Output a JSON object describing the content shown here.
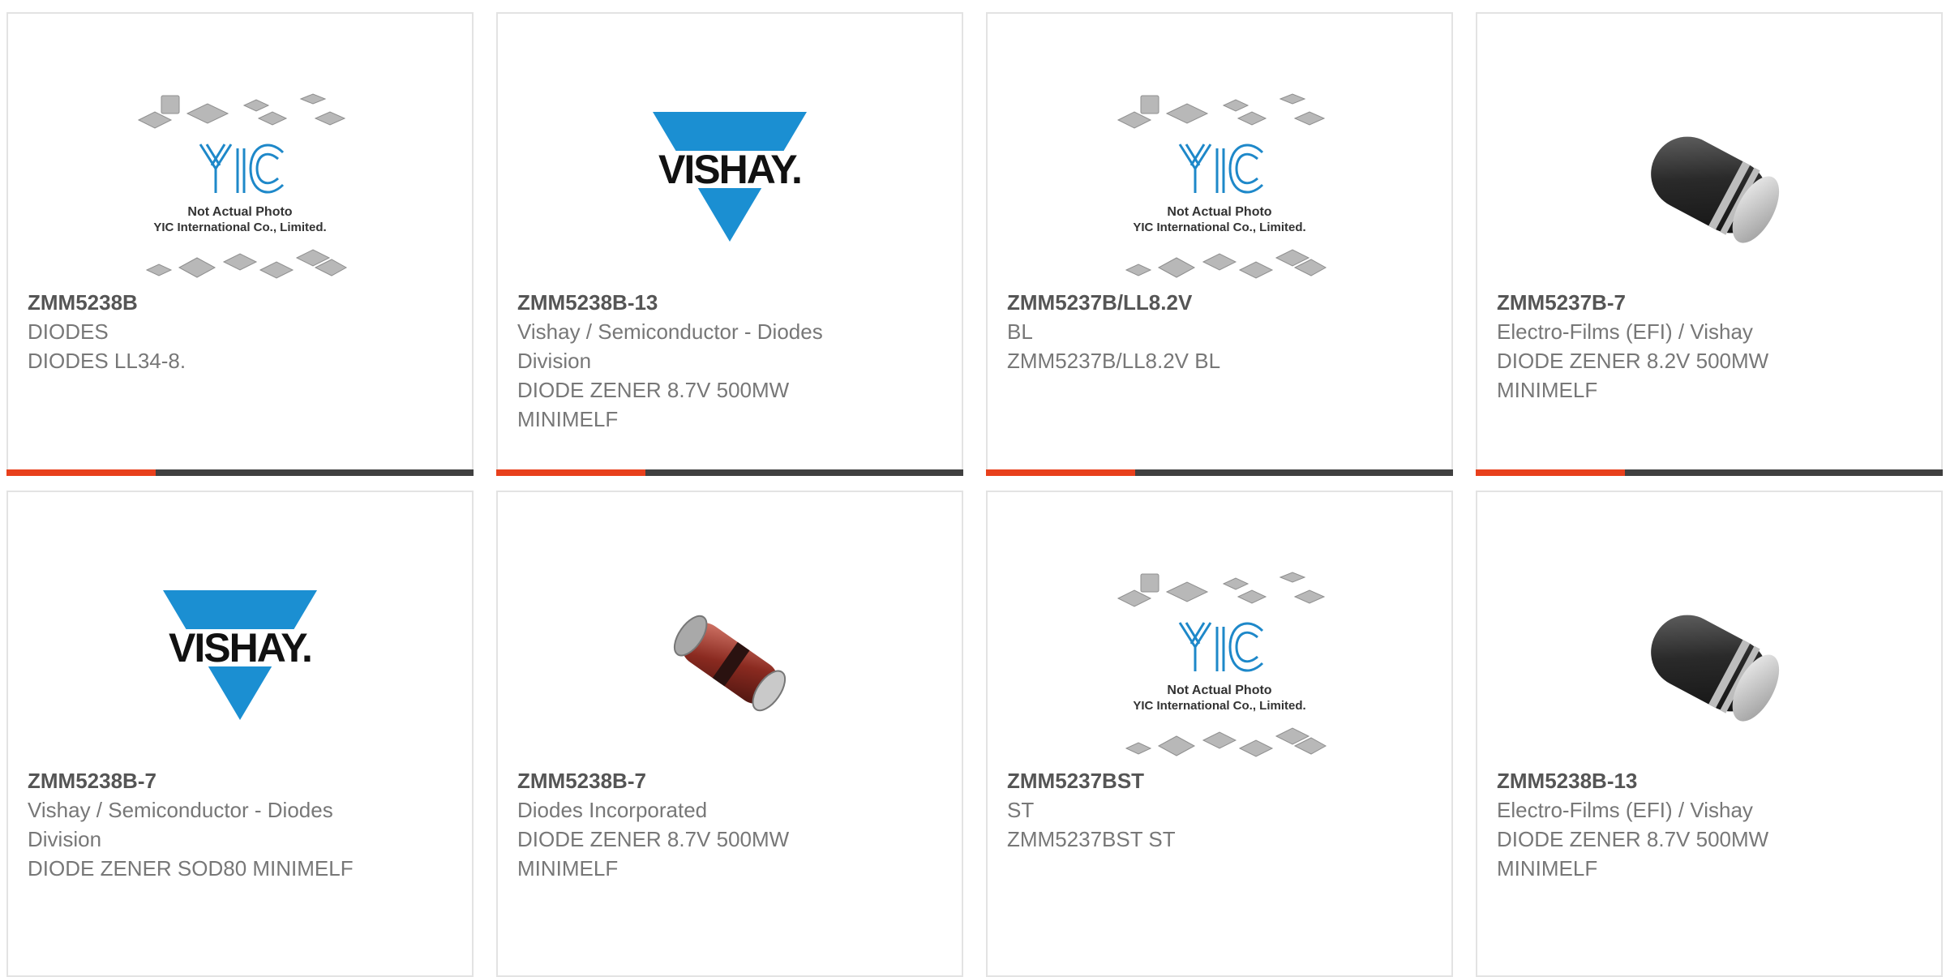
{
  "colors": {
    "accent": "#e8401c",
    "bar": "#404040",
    "vishay_blue": "#1b8fd2",
    "yic_blue": "#1e88c9"
  },
  "products": [
    {
      "part": "ZMM5238B",
      "manufacturer": "DIODES",
      "description": "DIODES LL34-8.",
      "image": "yic-placeholder",
      "image_text": {
        "line1": "Not Actual Photo",
        "line2": "YIC International Co., Limited.",
        "logo": "YIC"
      }
    },
    {
      "part": "ZMM5238B-13",
      "manufacturer": "Vishay / Semiconductor - Diodes Division",
      "description": "DIODE ZENER 8.7V 500MW MINIMELF",
      "image": "vishay-logo",
      "image_text": {
        "logo": "VISHAY."
      }
    },
    {
      "part": "ZMM5237B/LL8.2V",
      "manufacturer": "BL",
      "description": "ZMM5237B/LL8.2V BL",
      "image": "yic-placeholder",
      "image_text": {
        "line1": "Not Actual Photo",
        "line2": "YIC International Co., Limited.",
        "logo": "YIC"
      }
    },
    {
      "part": "ZMM5237B-7",
      "manufacturer": "Electro-Films (EFI) / Vishay",
      "description": "DIODE ZENER 8.2V 500MW MINIMELF",
      "image": "minimelf-black"
    },
    {
      "part": "ZMM5238B-7",
      "manufacturer": "Vishay / Semiconductor - Diodes Division",
      "description": "DIODE ZENER SOD80 MINIMELF",
      "image": "vishay-logo",
      "image_text": {
        "logo": "VISHAY."
      }
    },
    {
      "part": "ZMM5238B-7",
      "manufacturer": "Diodes Incorporated",
      "description": "DIODE ZENER 8.7V 500MW MINIMELF",
      "image": "minimelf-red"
    },
    {
      "part": "ZMM5237BST",
      "manufacturer": "ST",
      "description": "ZMM5237BST ST",
      "image": "yic-placeholder",
      "image_text": {
        "line1": "Not Actual Photo",
        "line2": "YIC International Co., Limited.",
        "logo": "YIC"
      }
    },
    {
      "part": "ZMM5238B-13",
      "manufacturer": "Electro-Films (EFI) / Vishay",
      "description": "DIODE ZENER 8.7V 500MW MINIMELF",
      "image": "minimelf-black"
    }
  ]
}
